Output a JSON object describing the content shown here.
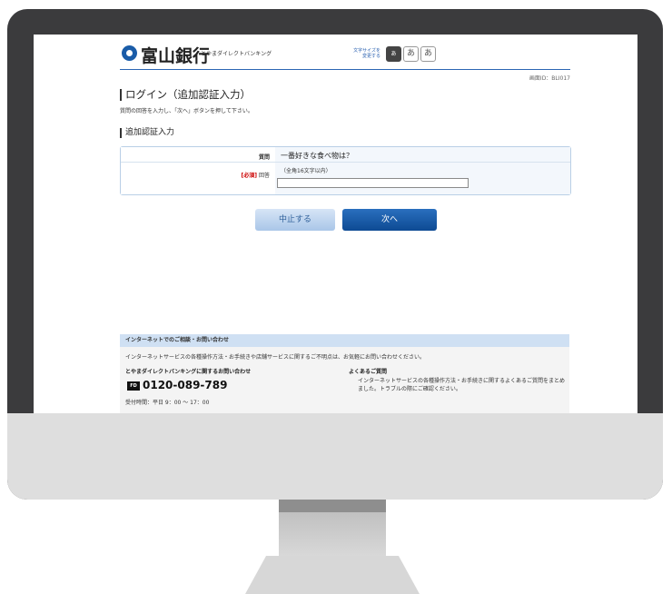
{
  "header": {
    "bank_name": "富山銀行",
    "service_name": "とやまダイレクトバンキング",
    "font_size_label": "文字サイズを 変更する",
    "font_size_small": "あ",
    "font_size_medium": "あ",
    "font_size_large": "あ",
    "screen_id": "画面ID：BLI017"
  },
  "page": {
    "title": "ログイン（追加認証入力）",
    "instruction": "質問の回答を入力し、「次へ」ボタンを押して下さい。",
    "section_title": "追加認証入力"
  },
  "form": {
    "question_label": "質問",
    "question_text": "一番好きな食べ物は？",
    "required_tag": "[必須]",
    "answer_label": "回答",
    "answer_hint": "（全角16文字以内）",
    "answer_value": ""
  },
  "buttons": {
    "cancel": "中止する",
    "next": "次へ"
  },
  "footer": {
    "bar_title": "インターネットでのご相談・お問い合わせ",
    "note": "インターネットサービスの各種操作方法・お手続きや店舗サービスに関するご不明点は、お気軽にお問い合わせください。",
    "contact_heading": "とやまダイレクトバンキングに関するお問い合わせ",
    "freedial_icon": "FD",
    "phone": "0120-089-789",
    "hours": "受付時間：平日 9：00 ～ 17：00",
    "faq_heading": "よくあるご質問",
    "faq_text": "インターネットサービスの各種操作方法・お手続きに関するよくあるご質問をまとめました。トラブルの際にご確認ください。"
  },
  "colors": {
    "brand_blue": "#1a5ca8",
    "primary_button": "#0d4a93",
    "panel_blue": "#cfe0f3"
  }
}
